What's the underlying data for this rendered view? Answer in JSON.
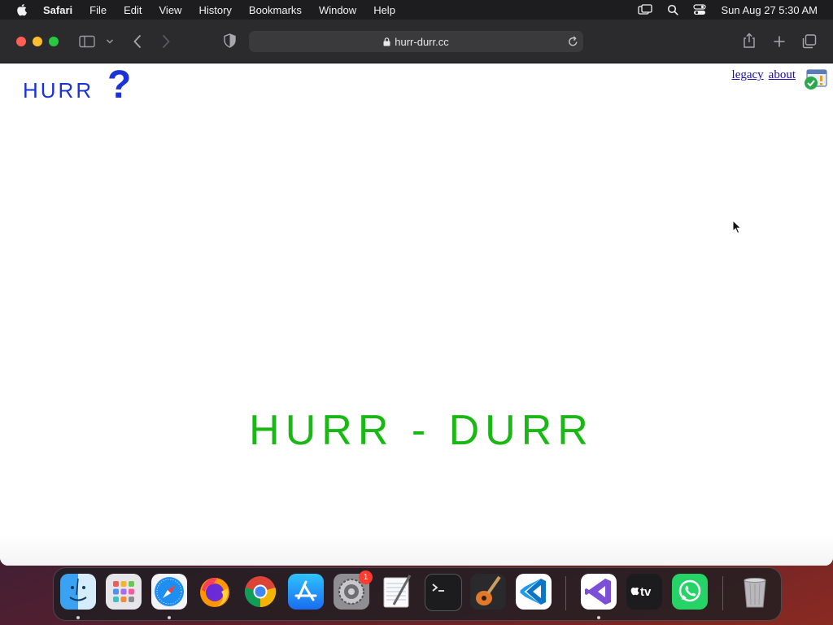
{
  "menubar": {
    "app": "Safari",
    "items": [
      "File",
      "Edit",
      "View",
      "History",
      "Bookmarks",
      "Window",
      "Help"
    ],
    "clock": "Sun Aug 27  5:30 AM",
    "status_icons": [
      "screen-mirroring-icon",
      "spotlight-search-icon",
      "control-center-icon"
    ]
  },
  "browser": {
    "url": "hurr-durr.cc",
    "toolbar_icons": [
      "sidebar-icon",
      "chevron-down-icon",
      "back-icon",
      "forward-icon",
      "privacy-shield-icon",
      "lock-icon",
      "reload-icon",
      "share-icon",
      "new-tab-icon",
      "tab-overview-icon"
    ]
  },
  "page": {
    "logo_text": "HURR",
    "logo_mark": "?",
    "links": {
      "legacy": "legacy",
      "about": "about"
    },
    "title": "HURR - DURR",
    "colors": {
      "logo": "#1a33d6",
      "title": "#19b814",
      "link": "#1a0dab"
    }
  },
  "dock": {
    "apps": [
      "Finder",
      "Launchpad",
      "Safari",
      "Firefox",
      "Chrome",
      "App Store",
      "System Settings",
      "TextEdit",
      "Terminal",
      "GarageBand",
      "Visual Studio Code",
      "Visual Studio",
      "Apple TV",
      "WhatsApp",
      "Trash"
    ],
    "settings_badge": "1"
  }
}
